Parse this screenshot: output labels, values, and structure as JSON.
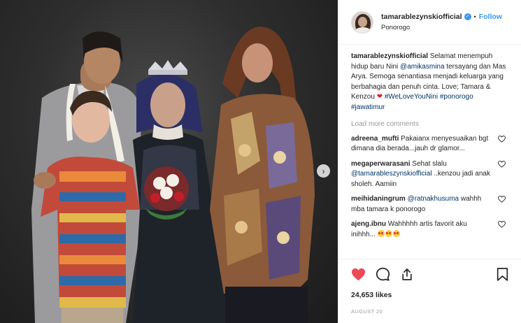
{
  "post": {
    "username": "tamarablezynskiofficial",
    "verified": true,
    "follow_label": "Follow",
    "location": "Ponorogo",
    "caption": {
      "username": "tamarablezynskiofficial",
      "text1": "Selamat menempuh hidup baru Nini",
      "mention": "@amikasmina",
      "text2": "tersayang dan Mas Arya. Semoga senantiasa menjadi keluarga yang berbahagia dan penuh cinta. Love; Tamara & Kenzou",
      "hashtag1": "#WeLoveYouNini",
      "hashtag2": "#ponorogo",
      "hashtag3": "#jawatimur"
    },
    "load_more": "Load more comments",
    "comments": [
      {
        "username": "adreena_mufti",
        "text": "Pakaianx menyesuaikan bgt dimana dia berada...jauh dr glamor..."
      },
      {
        "username": "megaperwarasani",
        "text": "Sehat slalu",
        "mention": "@tamarableszynskiofficial",
        "text_after": "..kenzou jadi anak sholeh. Aamiin"
      },
      {
        "username": "meihidaningrum",
        "mention": "@ratnakhusuma",
        "text_after": "wahhh mba tamara k ponorogo"
      },
      {
        "username": "ajeng.ibnu",
        "text": "Wahhhhh artis favorit aku inihhh..."
      }
    ],
    "likes": "24,653 likes",
    "date": "AUGUST 20",
    "icons": [
      "heart-icon",
      "comment-icon",
      "share-icon",
      "bookmark-icon",
      "next-arrow-icon",
      "verified-badge-icon"
    ],
    "colors": {
      "accent": "#3897f0",
      "like_red": "#ed4956",
      "muted": "#999999",
      "link": "#003569"
    }
  }
}
